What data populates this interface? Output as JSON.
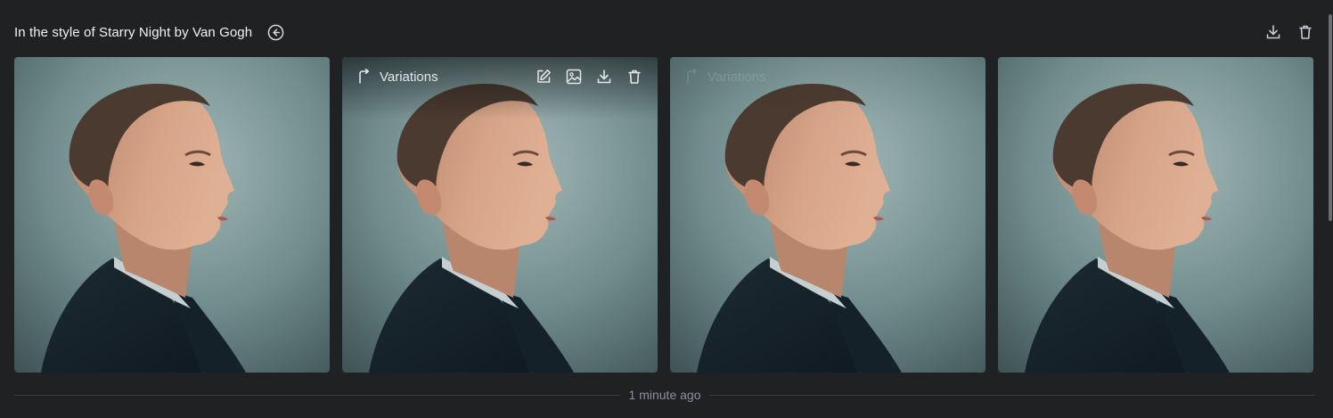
{
  "header": {
    "prompt": "In the style of Starry Night by Van Gogh",
    "back_icon": "arrow-left-circle-icon",
    "download_icon": "download-icon",
    "delete_icon": "trash-icon"
  },
  "images": [
    {
      "index": 1
    },
    {
      "index": 2,
      "overlay": {
        "variations_label": "Variations",
        "icons": [
          "edit-icon",
          "image-icon",
          "download-icon",
          "trash-icon"
        ]
      }
    },
    {
      "index": 3,
      "overlay_faint": {
        "variations_label": "Variations"
      }
    },
    {
      "index": 4
    }
  ],
  "footer": {
    "timestamp": "1 minute ago"
  },
  "colors": {
    "background": "#202123",
    "text": "#ececf1",
    "muted": "#8e8ea0",
    "divider": "#3b3d42"
  }
}
